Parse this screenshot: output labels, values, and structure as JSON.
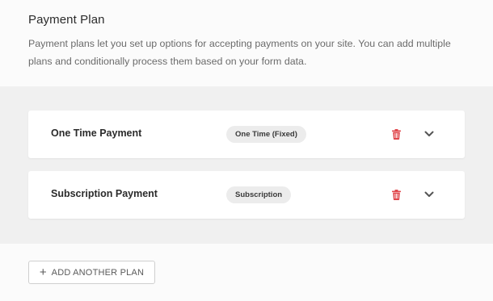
{
  "header": {
    "title": "Payment Plan",
    "description": "Payment plans let you set up options for accepting payments on your site. You can add multiple plans and conditionally process them based on your form data."
  },
  "plans": [
    {
      "name": "One Time Payment",
      "type": "One Time (Fixed)"
    },
    {
      "name": "Subscription Payment",
      "type": "Subscription"
    }
  ],
  "actions": {
    "add_plan_icon": "+",
    "add_plan_label": "ADD ANOTHER PLAN"
  },
  "colors": {
    "delete_icon": "#e0484d",
    "chevron_icon": "#555555",
    "plans_background": "#f0f0f0"
  },
  "icons": {
    "delete": "trash-icon",
    "expand": "chevron-down-icon"
  }
}
